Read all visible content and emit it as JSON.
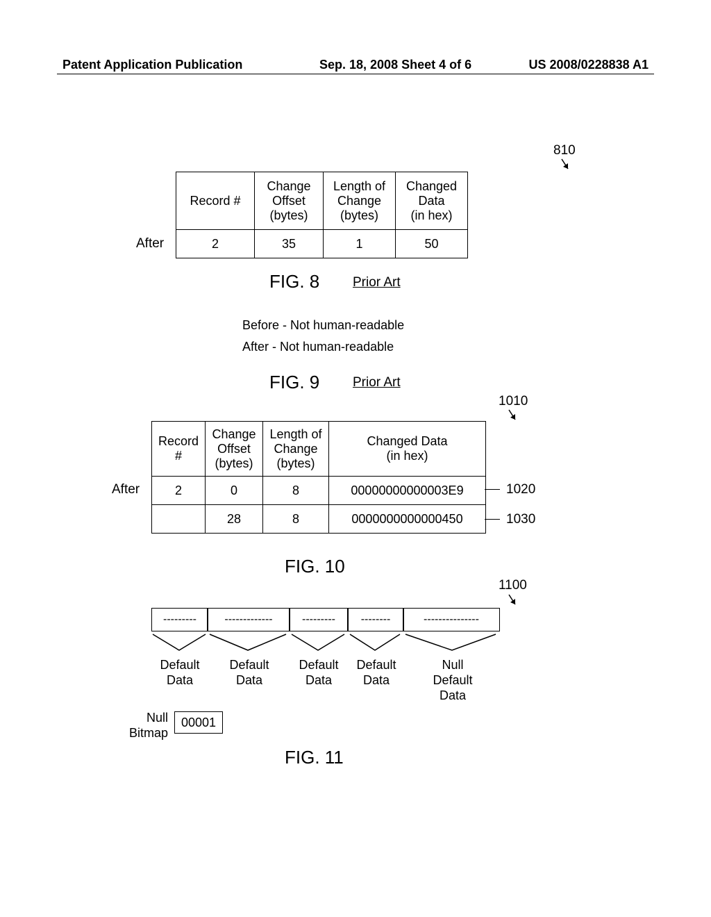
{
  "header": {
    "left": "Patent Application Publication",
    "center": "Sep. 18, 2008  Sheet 4 of 6",
    "right": "US 2008/0228838 A1"
  },
  "fig8": {
    "ref": "810",
    "after": "After",
    "headers": {
      "c1": "Record #",
      "c2": "Change\nOffset\n(bytes)",
      "c3": "Length of\nChange\n(bytes)",
      "c4": "Changed\nData\n(in hex)"
    },
    "row": {
      "c1": "2",
      "c2": "35",
      "c3": "1",
      "c4": "50"
    },
    "caption": "FIG. 8",
    "prior_art": "Prior Art"
  },
  "fig9": {
    "line1": "Before - Not human-readable",
    "line2": "After - Not human-readable",
    "caption": "FIG. 9",
    "prior_art": "Prior Art"
  },
  "fig10": {
    "ref": "1010",
    "after": "After",
    "headers": {
      "c1": "Record\n#",
      "c2": "Change\nOffset\n(bytes)",
      "c3": "Length of\nChange\n(bytes)",
      "c4": "Changed Data\n(in hex)"
    },
    "row1": {
      "c1": "2",
      "c2": "0",
      "c3": "8",
      "c4": "00000000000003E9",
      "ref": "1020"
    },
    "row2": {
      "c1": "",
      "c2": "28",
      "c3": "8",
      "c4": "0000000000000450",
      "ref": "1030"
    },
    "caption": "FIG. 10"
  },
  "fig11": {
    "ref": "1100",
    "boxes": {
      "b1": "---------",
      "b2": "-------------",
      "b3": "---------",
      "b4": "--------",
      "b5": "---------------"
    },
    "labels": {
      "l1": "Default\nData",
      "l2": "Default\nData",
      "l3": "Default\nData",
      "l4": "Default\nData",
      "l5": "Null\nDefault\nData"
    },
    "null_bitmap_label": "Null\nBitmap",
    "null_bitmap_value": "00001",
    "caption": "FIG. 11"
  }
}
